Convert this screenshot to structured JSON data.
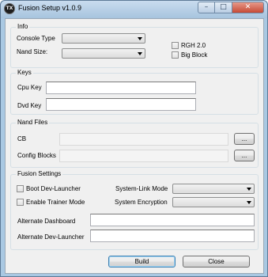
{
  "window": {
    "title": "Fusion Setup v1.0.9",
    "icon_text": "TX",
    "minimize_glyph": "–",
    "maximize_glyph": "□",
    "close_glyph": "✕"
  },
  "info": {
    "title": "Info",
    "console_type_label": "Console Type",
    "console_type_value": "",
    "nand_size_label": "Nand Size:",
    "nand_size_value": "",
    "rgh2_label": "RGH 2.0",
    "rgh2_checked": false,
    "big_block_label": "Big Block",
    "big_block_checked": false
  },
  "keys": {
    "title": "Keys",
    "cpu_key_label": "Cpu Key",
    "cpu_key_value": "",
    "dvd_key_label": "Dvd Key",
    "dvd_key_value": ""
  },
  "nand_files": {
    "title": "Nand Files",
    "cb_label": "CB",
    "cb_value": "",
    "cb_browse_label": "...",
    "config_blocks_label": "Config Blocks",
    "config_blocks_value": "",
    "config_blocks_browse_label": "..."
  },
  "fusion_settings": {
    "title": "Fusion Settings",
    "boot_dev_launcher_label": "Boot Dev-Launcher",
    "boot_dev_launcher_checked": false,
    "enable_trainer_mode_label": "Enable Trainer Mode",
    "enable_trainer_mode_checked": false,
    "system_link_mode_label": "System-Link Mode",
    "system_link_mode_value": "",
    "system_encryption_label": "System Encryption",
    "system_encryption_value": "",
    "alternate_dashboard_label": "Alternate Dashboard",
    "alternate_dashboard_value": "",
    "alternate_dev_launcher_label": "Alternate Dev-Launcher",
    "alternate_dev_launcher_value": ""
  },
  "footer": {
    "build_label": "Build",
    "close_label": "Close"
  }
}
